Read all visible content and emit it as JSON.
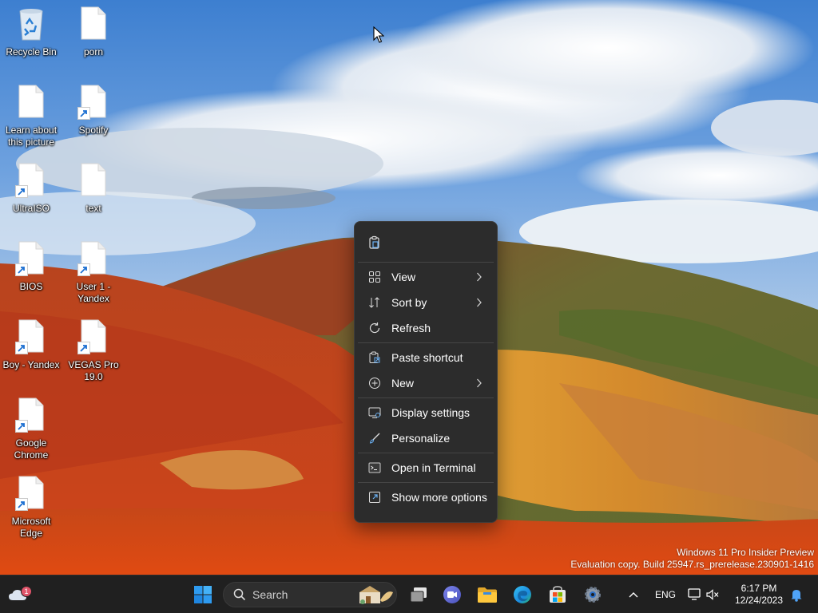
{
  "desktop": {
    "icons": [
      {
        "label": "Recycle Bin",
        "type": "recycle-bin"
      },
      {
        "label": "porn",
        "type": "file"
      },
      {
        "label": "Learn about this picture",
        "type": "file"
      },
      {
        "label": "Spotify",
        "type": "shortcut"
      },
      {
        "label": "UltraISO",
        "type": "shortcut"
      },
      {
        "label": "text",
        "type": "file"
      },
      {
        "label": "BIOS",
        "type": "shortcut"
      },
      {
        "label": "User 1 - Yandex",
        "type": "shortcut"
      },
      {
        "label": "Boy - Yandex",
        "type": "shortcut"
      },
      {
        "label": "VEGAS Pro 19.0",
        "type": "shortcut"
      },
      {
        "label": "Google Chrome",
        "type": "shortcut"
      },
      {
        "label": "Microsoft Edge",
        "type": "shortcut"
      }
    ]
  },
  "context_menu": {
    "top_icons": [
      "paste-icon"
    ],
    "items": [
      {
        "label": "View",
        "icon": "grid-icon",
        "submenu": true
      },
      {
        "label": "Sort by",
        "icon": "sort-icon",
        "submenu": true
      },
      {
        "label": "Refresh",
        "icon": "refresh-icon",
        "submenu": false
      },
      {
        "label": "Paste shortcut",
        "icon": "paste-shortcut-icon",
        "submenu": false
      },
      {
        "label": "New",
        "icon": "plus-circle-icon",
        "submenu": true
      },
      {
        "label": "Display settings",
        "icon": "display-settings-icon",
        "submenu": false
      },
      {
        "label": "Personalize",
        "icon": "brush-icon",
        "submenu": false
      },
      {
        "label": "Open in Terminal",
        "icon": "terminal-icon",
        "submenu": false
      },
      {
        "label": "Show more options",
        "icon": "more-options-icon",
        "submenu": false
      }
    ]
  },
  "watermark": {
    "line1": "Windows 11 Pro Insider Preview",
    "line2": "Evaluation copy. Build 25947.rs_prerelease.230901-1416"
  },
  "taskbar": {
    "weather_badge": "1",
    "search_placeholder": "Search",
    "pinned": [
      "task-view-icon",
      "meet-icon",
      "file-explorer-icon",
      "edge-icon",
      "store-icon",
      "settings-icon"
    ],
    "language": "ENG",
    "time": "6:17 PM",
    "date": "12/24/2023"
  },
  "colors": {
    "menu_bg": "#2c2c2c",
    "taskbar_bg": "#202020",
    "accent": "#0078d4"
  }
}
